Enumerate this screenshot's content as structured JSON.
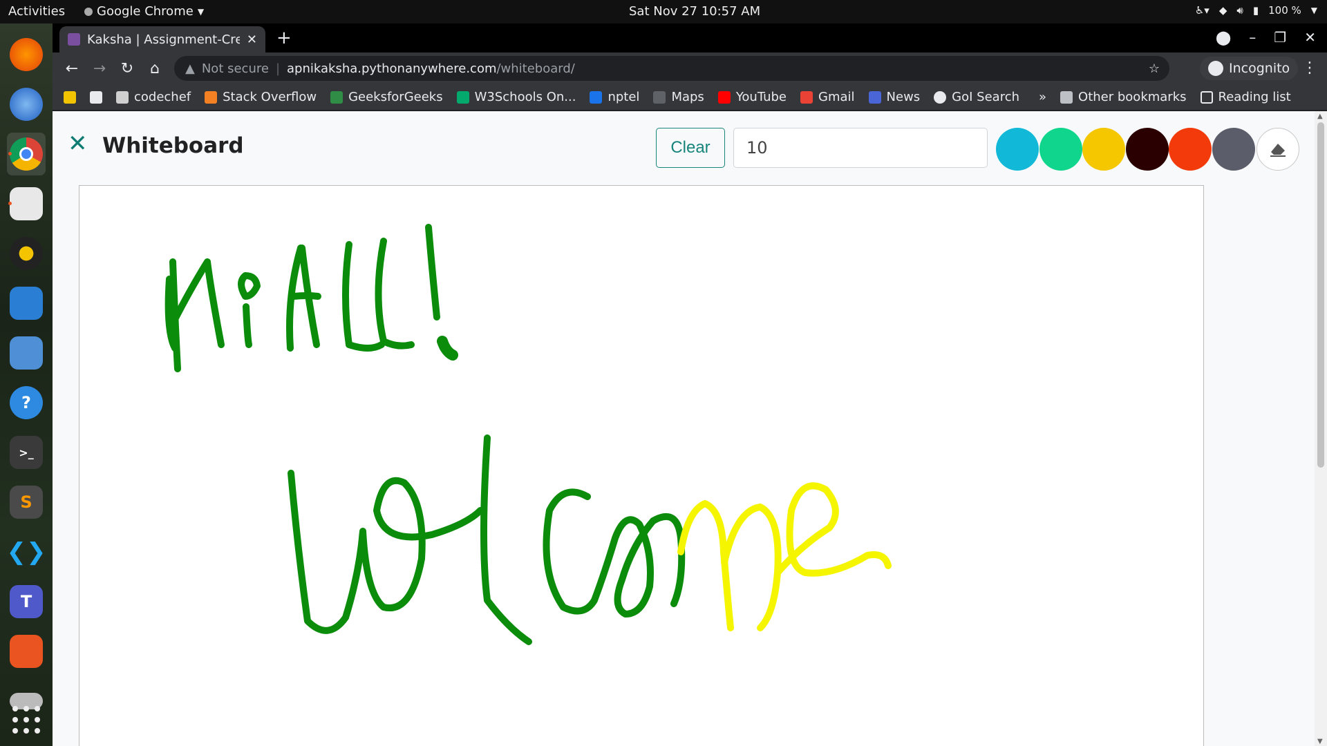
{
  "system": {
    "activities": "Activities",
    "app_name": "Google Chrome",
    "clock": "Sat Nov 27  10:57 AM",
    "battery": "100 %"
  },
  "browser": {
    "tab_title": "Kaksha | Assignment-Crea",
    "url_warning": "Not secure",
    "url_host": "apnikaksha.pythonanywhere.com",
    "url_path": "/whiteboard/",
    "profile": "Incognito",
    "bookmarks": [
      {
        "label": "",
        "color": "#f2c300"
      },
      {
        "label": "",
        "color": "#e8eaed"
      },
      {
        "label": "codechef",
        "color": "#cfcfcf"
      },
      {
        "label": "Stack Overflow",
        "color": "#f48024"
      },
      {
        "label": "GeeksforGeeks",
        "color": "#2f8d46"
      },
      {
        "label": "W3Schools On...",
        "color": "#04aa6d"
      },
      {
        "label": "nptel",
        "color": "#1a73e8"
      },
      {
        "label": "Maps",
        "color": "#5f6368"
      },
      {
        "label": "YouTube",
        "color": "#ff0000"
      },
      {
        "label": "Gmail",
        "color": "#ea4335"
      },
      {
        "label": "News",
        "color": "#4a66d6"
      },
      {
        "label": "GoI Search",
        "color": "#e8eaed"
      }
    ],
    "more": "»",
    "other_bookmarks": "Other bookmarks",
    "reading_list": "Reading list"
  },
  "page": {
    "title": "Whiteboard",
    "clear_label": "Clear",
    "size_value": "10",
    "swatches": [
      "#12b8d7",
      "#0fd68c",
      "#f4c700",
      "#2a0000",
      "#f23a0a",
      "#5c5d6b"
    ]
  },
  "drawing": {
    "strokes_green": "#0b8c0b",
    "strokes_yellow": "#f5f500"
  }
}
